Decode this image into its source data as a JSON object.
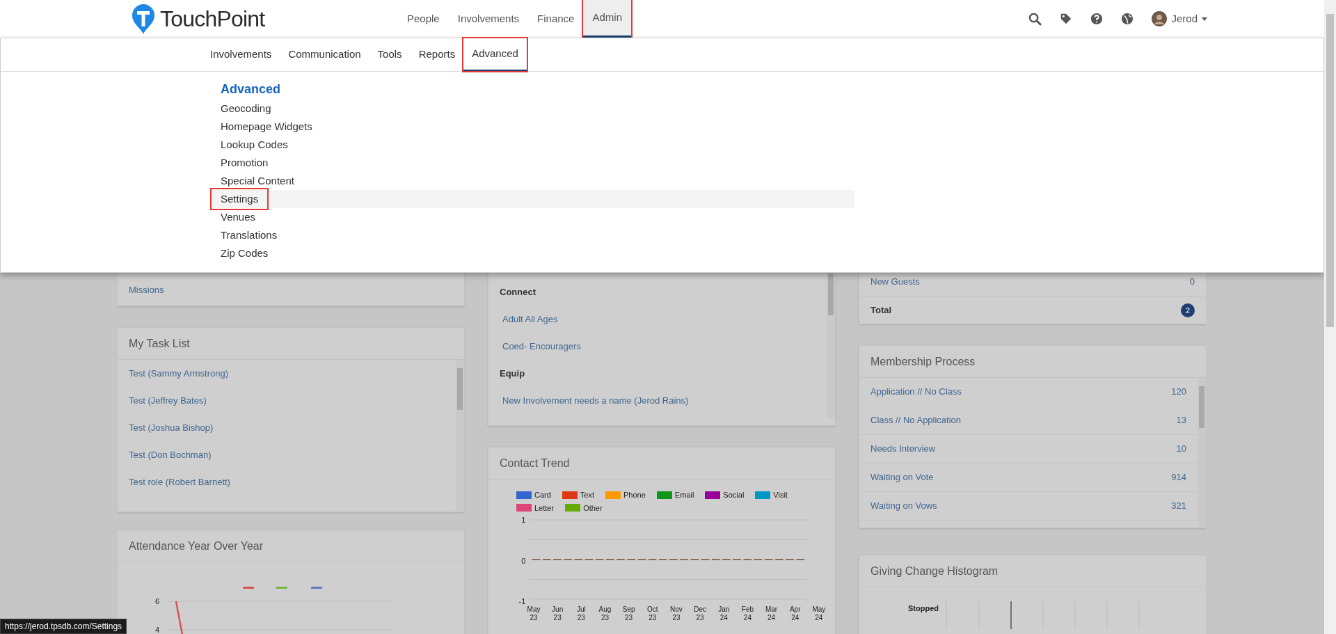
{
  "header": {
    "logo_text": "TouchPoint",
    "nav": [
      {
        "label": "People",
        "selected": false,
        "annotated": false
      },
      {
        "label": "Involvements",
        "selected": false,
        "annotated": false
      },
      {
        "label": "Finance",
        "selected": false,
        "annotated": false
      },
      {
        "label": "Admin",
        "selected": true,
        "annotated": true
      }
    ],
    "user": {
      "name": "Jerod"
    }
  },
  "subnav": [
    {
      "label": "Involvements",
      "selected": false,
      "annotated": false
    },
    {
      "label": "Communication",
      "selected": false,
      "annotated": false
    },
    {
      "label": "Tools",
      "selected": false,
      "annotated": false
    },
    {
      "label": "Reports",
      "selected": false,
      "annotated": false
    },
    {
      "label": "Advanced",
      "selected": true,
      "annotated": true
    }
  ],
  "dropdown": {
    "heading": "Advanced",
    "items": [
      {
        "label": "Geocoding",
        "hovered": false,
        "annotated": false
      },
      {
        "label": "Homepage Widgets",
        "hovered": false,
        "annotated": false
      },
      {
        "label": "Lookup Codes",
        "hovered": false,
        "annotated": false
      },
      {
        "label": "Promotion",
        "hovered": false,
        "annotated": false
      },
      {
        "label": "Special Content",
        "hovered": false,
        "annotated": false
      },
      {
        "label": "Settings",
        "hovered": true,
        "annotated": true
      },
      {
        "label": "Venues",
        "hovered": false,
        "annotated": false
      },
      {
        "label": "Translations",
        "hovered": false,
        "annotated": false
      },
      {
        "label": "Zip Codes",
        "hovered": false,
        "annotated": false
      }
    ]
  },
  "missions_card": {
    "link": "Missions"
  },
  "task_list": {
    "title": "My Task List",
    "items": [
      "Test (Sammy Armstrong)",
      "Test (Jeffrey Bates)",
      "Test (Joshua Bishop)",
      "Test (Don Bochman)",
      "Test role (Robert Barnett)"
    ]
  },
  "attendance": {
    "title": "Attendance Year Over Year",
    "y_labels": [
      "6",
      "4"
    ]
  },
  "involvements_card": {
    "groups": [
      {
        "heading": "Connect",
        "links": [
          "Adult All Ages",
          "Coed- Encouragers"
        ]
      },
      {
        "heading": "Equip",
        "links": [
          "New Involvement needs a name (Jerod Rains)"
        ]
      }
    ]
  },
  "contact_trend": {
    "title": "Contact Trend",
    "legend": [
      {
        "name": "Card",
        "color": "#3366cc"
      },
      {
        "name": "Text",
        "color": "#dc3912"
      },
      {
        "name": "Phone",
        "color": "#ff9900"
      },
      {
        "name": "Email",
        "color": "#109618"
      },
      {
        "name": "Social",
        "color": "#990099"
      },
      {
        "name": "Visit",
        "color": "#0099c6"
      },
      {
        "name": "Letter",
        "color": "#dd4477"
      },
      {
        "name": "Other",
        "color": "#66aa00"
      }
    ],
    "y_labels": [
      "1",
      "0",
      "-1"
    ],
    "x_labels": [
      "May 23",
      "Jun 23",
      "Jul 23",
      "Aug 23",
      "Sep 23",
      "Oct 23",
      "Nov 23",
      "Dec 23",
      "Jan 24",
      "Feb 24",
      "Mar 24",
      "Apr 24",
      "May 24"
    ]
  },
  "guests_card": {
    "rows": [
      {
        "label": "New Guests",
        "count": "0"
      }
    ],
    "total": {
      "label": "Total",
      "count": "2"
    }
  },
  "membership": {
    "title": "Membership Process",
    "rows": [
      {
        "label": "Application // No Class",
        "count": "120"
      },
      {
        "label": "Class // No Application",
        "count": "13"
      },
      {
        "label": "Needs Interview",
        "count": "10"
      },
      {
        "label": "Waiting on Vote",
        "count": "914"
      },
      {
        "label": "Waiting on Vows",
        "count": "321"
      }
    ]
  },
  "giving": {
    "title": "Giving Change Histogram",
    "label": "Stopped"
  },
  "status_url": "https://jerod.tpsdb.com/Settings"
}
